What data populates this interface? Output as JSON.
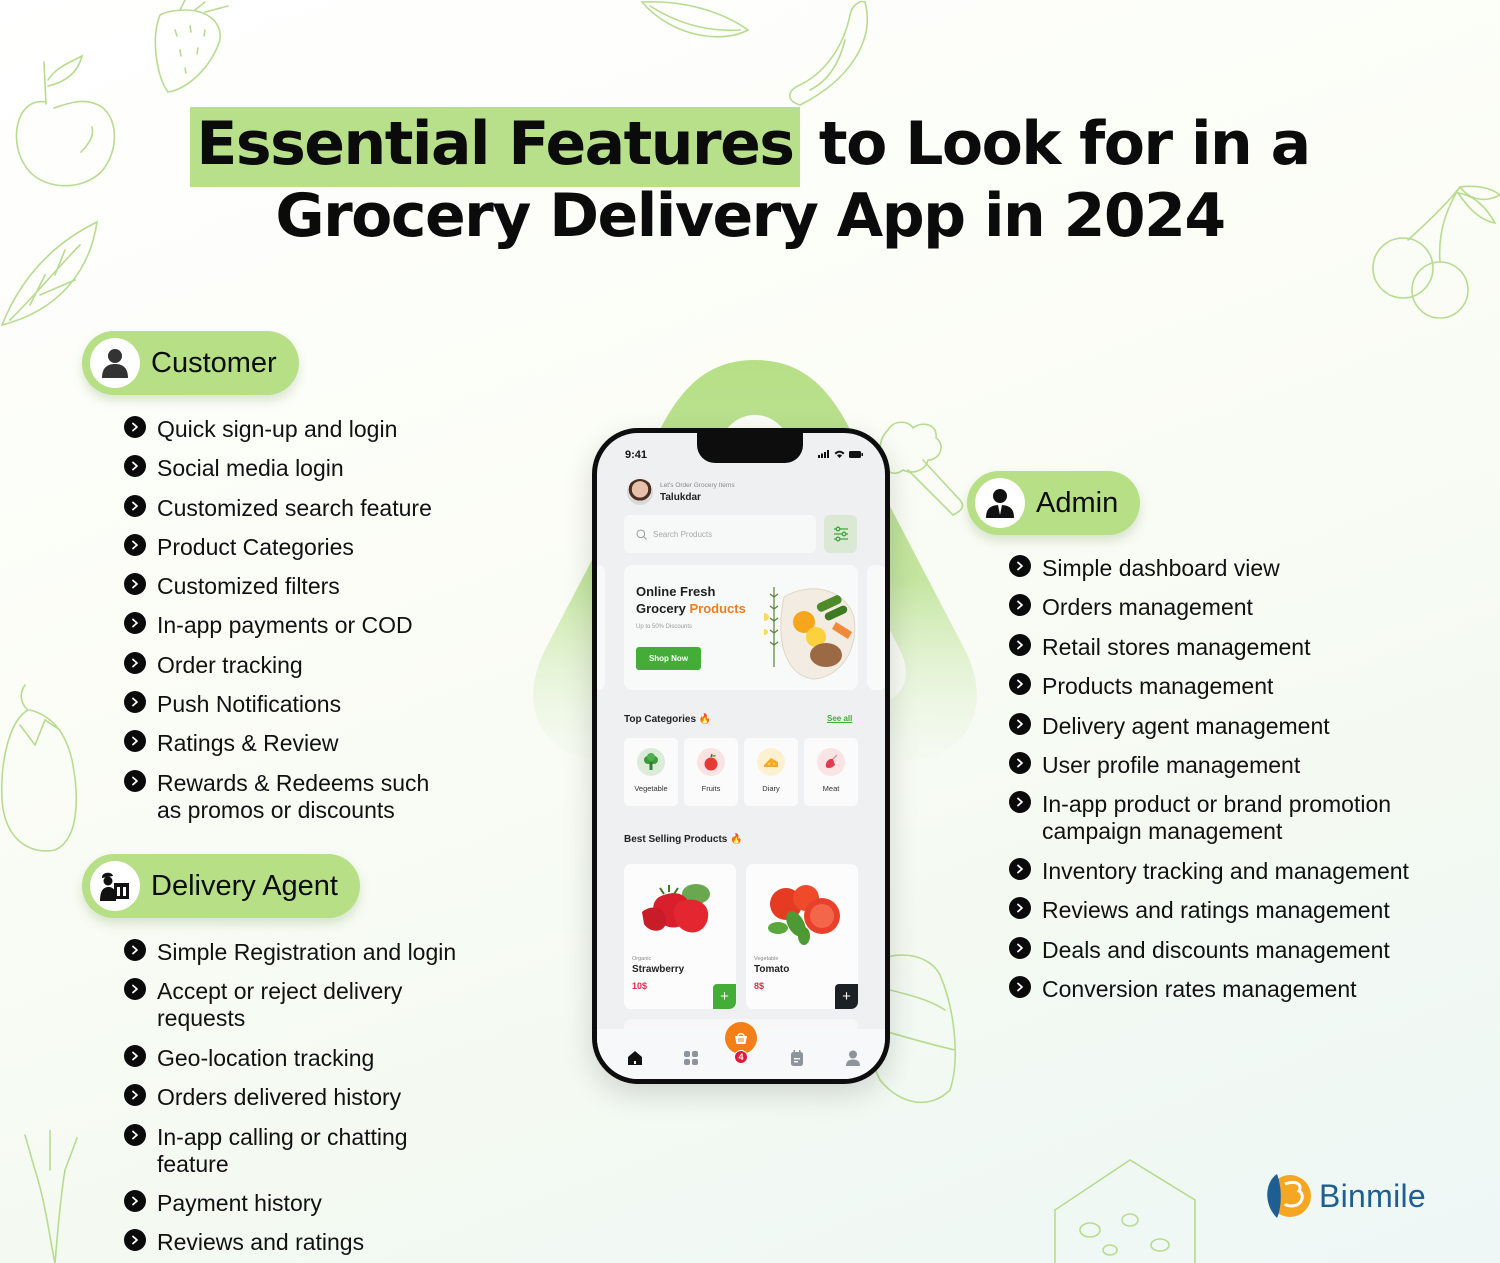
{
  "title": {
    "highlight": "Essential Features",
    "line1_rest": " to Look for in a",
    "line2": "Grocery Delivery App in 2024",
    "highlight_color": "#b8e08a"
  },
  "sections": {
    "customer": {
      "label": "Customer",
      "icon": "user-icon",
      "items": [
        "Quick sign-up and login",
        "Social media login",
        "Customized search feature",
        "Product Categories",
        "Customized filters",
        "In-app payments or COD",
        "Order tracking",
        "Push Notifications",
        "Ratings & Review",
        "Rewards & Redeems such as promos or discounts"
      ]
    },
    "delivery_agent": {
      "label": "Delivery Agent",
      "icon": "delivery-person-icon",
      "items": [
        "Simple Registration and login",
        "Accept or reject delivery requests",
        "Geo-location tracking",
        "Orders delivered history",
        "In-app calling or chatting feature",
        "Payment history",
        "Reviews and ratings"
      ]
    },
    "admin": {
      "label": "Admin",
      "icon": "admin-user-icon",
      "items": [
        "Simple dashboard view",
        "Orders management",
        "Retail stores management",
        "Products management",
        "Delivery agent management",
        "User profile management",
        "In-app product or brand promotion campaign management",
        "Inventory tracking and management",
        "Reviews and ratings management",
        "Deals and discounts management",
        "Conversion rates management"
      ]
    }
  },
  "phone": {
    "status_time": "9:41",
    "greeting": "Let's Order Grocery Items",
    "user_name": "Talukdar",
    "search_placeholder": "Search Products",
    "banner": {
      "title_line1": "Online Fresh",
      "title_line2_a": "Grocery ",
      "title_line2_b": "Products",
      "subtitle": "Up to 50% Discounts",
      "button": "Shop Now"
    },
    "top_categories": {
      "title": "Top Categories",
      "see_all": "See all",
      "items": [
        {
          "label": "Vegetable",
          "color": "#dcecd8"
        },
        {
          "label": "Fruits",
          "color": "#fbe3e3"
        },
        {
          "label": "Diary",
          "color": "#fdf1cf"
        },
        {
          "label": "Meat",
          "color": "#fbe3e6"
        }
      ]
    },
    "best_selling": {
      "title": "Best Selling Products",
      "items": [
        {
          "category": "Organic",
          "name": "Strawberry",
          "price": "10$",
          "add_color": "#43ad37"
        },
        {
          "category": "Vegetable",
          "name": "Tomato",
          "price": "8$",
          "add_color": "#1c2126"
        }
      ]
    },
    "cart_count": "4",
    "tabs": [
      "home",
      "categories",
      "cart",
      "orders",
      "profile"
    ]
  },
  "brand": {
    "name": "Binmile"
  },
  "colors": {
    "accent_green": "#b6df86",
    "shop_green": "#43ad37",
    "orange": "#f57f17",
    "price_red": "#e5294b",
    "brand_blue": "#1e5f93"
  }
}
